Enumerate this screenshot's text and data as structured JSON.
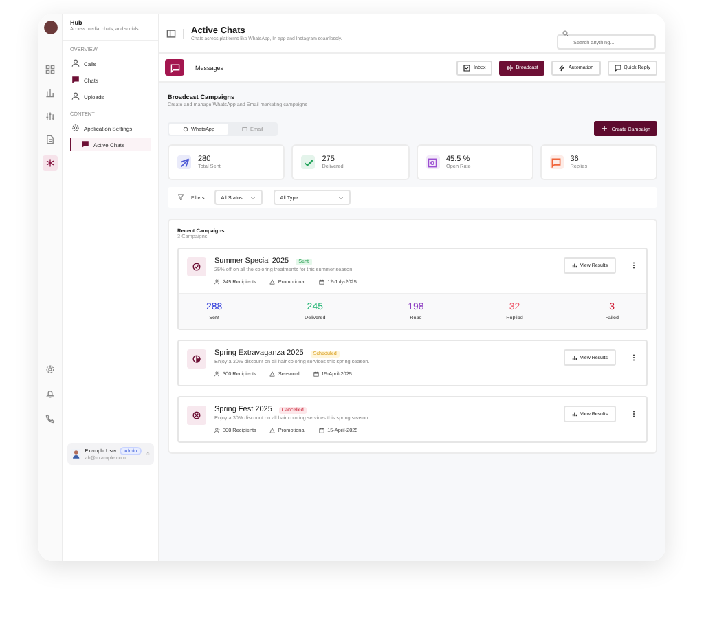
{
  "sidebar": {
    "title": "Hub",
    "subtitle": "Access media, chats, and socials",
    "rail": [
      {
        "kind": "grid",
        "selected": false
      },
      {
        "kind": "chart",
        "selected": false
      },
      {
        "kind": "sliders",
        "selected": false
      },
      {
        "kind": "document",
        "selected": false
      },
      {
        "kind": "asterisk",
        "selected": true
      }
    ],
    "rail_bottom": [
      {
        "kind": "gear"
      },
      {
        "kind": "bell"
      },
      {
        "kind": "phone"
      }
    ],
    "sections": [
      {
        "heading": "OVERVIEW",
        "items": [
          {
            "label": "Calls",
            "kind": "user",
            "selected": false
          },
          {
            "label": "Chats",
            "kind": "chat",
            "selected": false
          },
          {
            "label": "Uploads",
            "kind": "user",
            "selected": false
          }
        ]
      },
      {
        "heading": "CONTENT",
        "items": [
          {
            "label": "Application Settings",
            "kind": "gear",
            "selected": false,
            "children": [
              {
                "label": "Active Chats",
                "kind": "chat",
                "selected": true
              }
            ]
          }
        ]
      }
    ],
    "user": {
      "name": "Example User",
      "role": "admin",
      "email": "ab@example.com"
    }
  },
  "header": {
    "title": "Active Chats",
    "subtitle": "Chats across platforms like WhatsApp, In-app and Instagram seamlessly.",
    "search": {
      "placeholder": "Search anything..."
    }
  },
  "toolbar": {
    "title": "Messages",
    "buttons": [
      {
        "label": "Inbox",
        "kind": "inbox",
        "selected": false
      },
      {
        "label": "Broadcast",
        "kind": "broadcast",
        "selected": true
      },
      {
        "label": "Automation",
        "kind": "bolt",
        "selected": false
      },
      {
        "label": "Quick Reply",
        "kind": "reply",
        "selected": false
      }
    ]
  },
  "broadcast": {
    "title": "Broadcast Campaigns",
    "subtitle": "Create and manage WhatsApp and Email marketing campaigns",
    "channels": [
      {
        "label": "WhatsApp",
        "kind": "whatsapp",
        "selected": true
      },
      {
        "label": "Email",
        "kind": "email",
        "selected": false
      }
    ],
    "create_button": "Create Campaign",
    "stats": [
      {
        "value": "280",
        "label": "Total Sent",
        "kind": "send",
        "color": "#4f5bd5"
      },
      {
        "value": "275",
        "label": "Delivered",
        "kind": "check",
        "color": "#22a35a"
      },
      {
        "value": "45.5 %",
        "label": "Open Rate",
        "kind": "eye",
        "color": "#9b4fd1"
      },
      {
        "value": "36",
        "label": "Replies",
        "kind": "reply",
        "color": "#f0643a"
      }
    ],
    "filters": {
      "label": "Filters :",
      "status": "All Status",
      "type": "All Type"
    }
  },
  "recent": {
    "title": "Recent Campaigns",
    "count": "3 Campaigns",
    "campaigns": [
      {
        "title": "Summer Special 2025",
        "status": "Sent",
        "kind": "sent",
        "description": "25% off on all the coloring treatments for this summer season",
        "recipients": "245 Recipients",
        "type": "Promotional",
        "date": "12-July-2025",
        "action": "View Results",
        "metrics": [
          {
            "value": "288",
            "label": "Sent",
            "color": "#2f3bdb"
          },
          {
            "value": "245",
            "label": "Delivered",
            "color": "#22b573"
          },
          {
            "value": "198",
            "label": "Read",
            "color": "#8e3fc2"
          },
          {
            "value": "32",
            "label": "Replied",
            "color": "#f0566a"
          },
          {
            "value": "3",
            "label": "Failed",
            "color": "#d0102a"
          }
        ]
      },
      {
        "title": "Spring Extravaganza 2025",
        "status": "Scheduled",
        "kind": "scheduled",
        "description": "Enjoy a 30% discount on all hair coloring services this spring season.",
        "recipients": "300 Recipients",
        "type": "Seasonal",
        "date": "15-April-2025",
        "action": "View Results"
      },
      {
        "title": "Spring Fest 2025",
        "status": "Cancelled",
        "kind": "cancelled",
        "description": "Enjoy a 30% discount on all hair coloring services this spring season.",
        "recipients": "300 Recipients",
        "type": "Promotional",
        "date": "15-April-2025",
        "action": "View Results"
      }
    ]
  }
}
